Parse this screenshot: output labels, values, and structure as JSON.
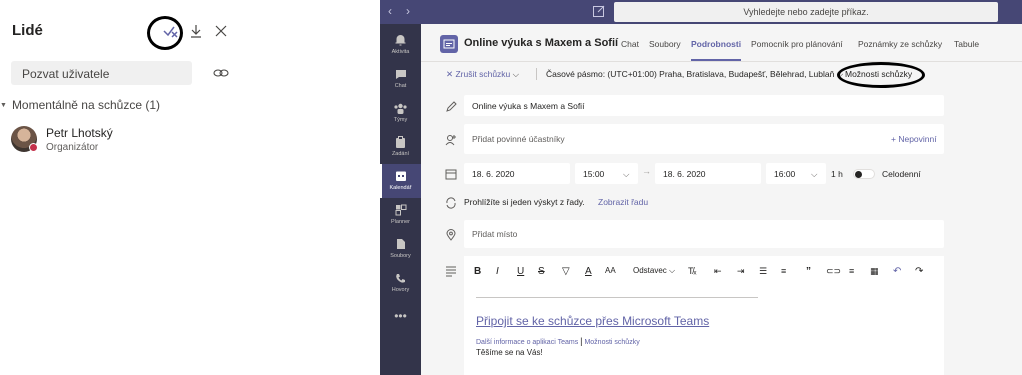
{
  "people_panel": {
    "title": "Lidé",
    "invite_placeholder": "Pozvat uživatele",
    "section_label": "Momentálně na schůzce (1)",
    "participant": {
      "name": "Petr Lhotský",
      "role": "Organizátor"
    },
    "icons": [
      "check-x-icon",
      "download-icon",
      "close-icon",
      "link-icon",
      "chevron-down-icon"
    ]
  },
  "teams": {
    "search_placeholder": "Vyhledejte nebo zadejte příkaz.",
    "rail": [
      {
        "label": "Aktivita",
        "icon": "bell-icon"
      },
      {
        "label": "Chat",
        "icon": "chat-icon"
      },
      {
        "label": "Týmy",
        "icon": "teams-icon"
      },
      {
        "label": "Zadání",
        "icon": "assignments-icon"
      },
      {
        "label": "Kalendář",
        "icon": "calendar-icon",
        "active": true
      },
      {
        "label": "Planner",
        "icon": "planner-icon"
      },
      {
        "label": "Soubory",
        "icon": "files-icon"
      },
      {
        "label": "Hovory",
        "icon": "calls-icon"
      }
    ],
    "meeting_title": "Online výuka s Maxem a Sofií",
    "tabs": [
      "Chat",
      "Soubory",
      "Podrobnosti",
      "Pomocník pro plánování",
      "Poznámky ze schůzky",
      "Tabule"
    ],
    "active_tab": "Podrobnosti",
    "toolbar": {
      "cancel": "Zrušit schůzku",
      "timezone": "Časové pásmo: (UTC+01:00) Praha, Bratislava, Budapešť, Bělehrad, Lublaň",
      "options": "Možnosti schůzky"
    },
    "form": {
      "title_value": "Online výuka s Maxem a Sofií",
      "attendees_placeholder": "Přidat povinné účastníky",
      "optional_link": "+ Nepovinní",
      "start_date": "18. 6. 2020",
      "start_time": "15:00",
      "end_date": "18. 6. 2020",
      "end_time": "16:00",
      "duration": "1 h",
      "allday_label": "Celodenní",
      "recurrence_text": "Prohlížíte si jeden výskyt z řady.",
      "recurrence_link": "Zobrazit řadu",
      "location_placeholder": "Přidat místo"
    },
    "editor": {
      "style_label": "Odstavec",
      "join_link": "Připojit se ke schůzce přes Microsoft Teams",
      "info_link": "Další informace o aplikaci Teams",
      "options_link": "Možnosti schůzky",
      "separator": "|",
      "greeting": "Těšíme se na Vás!"
    },
    "accent_color": "#6264a7"
  }
}
